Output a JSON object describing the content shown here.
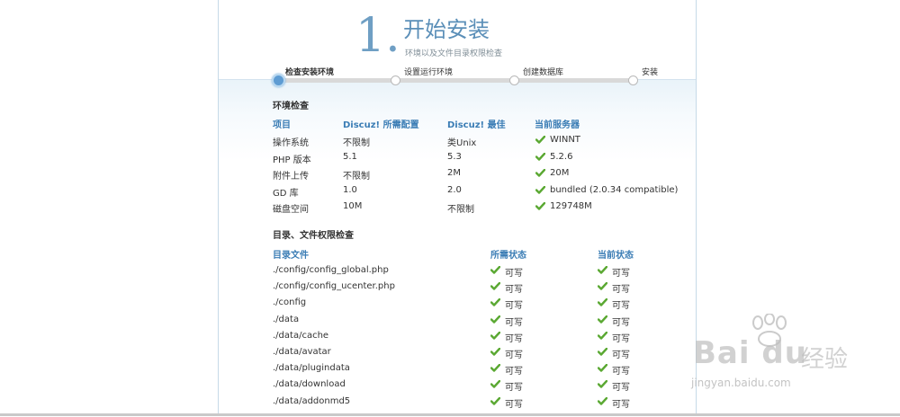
{
  "header": {
    "step_number": "1.",
    "title": "开始安装",
    "subtitle": "环境以及文件目录权限检查"
  },
  "steps": [
    {
      "label": "检查安装环境",
      "active": true
    },
    {
      "label": "设置运行环境",
      "active": false
    },
    {
      "label": "创建数据库",
      "active": false
    },
    {
      "label": "安装",
      "active": false
    }
  ],
  "env_check": {
    "title": "环境检查",
    "headers": [
      "项目",
      "Discuz! 所需配置",
      "Discuz! 最佳",
      "当前服务器"
    ],
    "rows": [
      [
        "操作系统",
        "不限制",
        "类Unix",
        "WINNT"
      ],
      [
        "PHP 版本",
        "5.1",
        "5.3",
        "5.2.6"
      ],
      [
        "附件上传",
        "不限制",
        "2M",
        "20M"
      ],
      [
        "GD 库",
        "1.0",
        "2.0",
        "bundled (2.0.34 compatible)"
      ],
      [
        "磁盘空间",
        "10M",
        "不限制",
        "129748M"
      ]
    ]
  },
  "dir_check": {
    "title": "目录、文件权限检查",
    "headers": [
      "目录文件",
      "所需状态",
      "当前状态"
    ],
    "rows": [
      [
        "./config/config_global.php",
        "可写",
        "可写"
      ],
      [
        "./config/config_ucenter.php",
        "可写",
        "可写"
      ],
      [
        "./config",
        "可写",
        "可写"
      ],
      [
        "./data",
        "可写",
        "可写"
      ],
      [
        "./data/cache",
        "可写",
        "可写"
      ],
      [
        "./data/avatar",
        "可写",
        "可写"
      ],
      [
        "./data/plugindata",
        "可写",
        "可写"
      ],
      [
        "./data/download",
        "可写",
        "可写"
      ],
      [
        "./data/addonmd5",
        "可写",
        "可写"
      ]
    ]
  },
  "colors": {
    "accent": "#3b7db5",
    "check": "#5aa832"
  },
  "watermark": {
    "brand": "Bai du",
    "brand_cn": "经验",
    "url": "jingyan.baidu.com"
  }
}
